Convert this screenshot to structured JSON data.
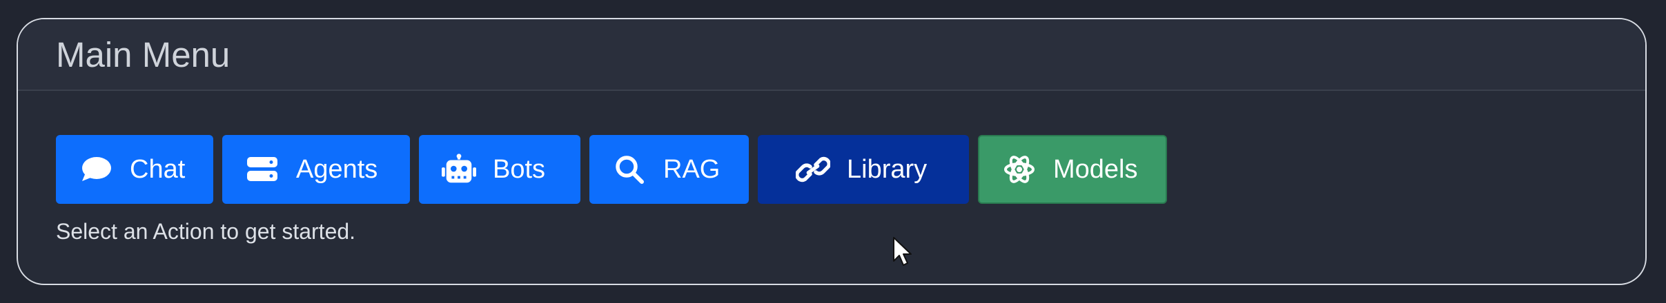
{
  "panel": {
    "title": "Main Menu",
    "helper_text": "Select an Action to get started."
  },
  "buttons": [
    {
      "label": "Chat",
      "icon": "speech-bubble-icon",
      "color": "#0d6efd"
    },
    {
      "label": "Agents",
      "icon": "server-icon",
      "color": "#0d6efd"
    },
    {
      "label": "Bots",
      "icon": "robot-icon",
      "color": "#0d6efd"
    },
    {
      "label": "RAG",
      "icon": "search-icon",
      "color": "#0d6efd"
    },
    {
      "label": "Library",
      "icon": "link-icon",
      "color": "#05309a"
    },
    {
      "label": "Models",
      "icon": "atom-icon",
      "color": "#3a9a68"
    }
  ],
  "colors": {
    "background": "#212530",
    "card": "#262b37",
    "primary": "#0d6efd",
    "active": "#05309a",
    "success": "#3a9a68"
  }
}
